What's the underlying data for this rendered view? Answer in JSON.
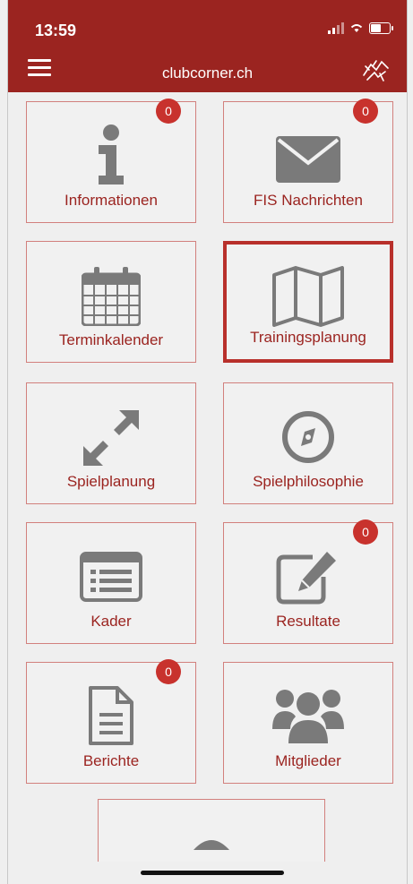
{
  "status": {
    "time": "13:59"
  },
  "header": {
    "title": "clubcorner.ch"
  },
  "tiles": [
    {
      "label": "Informationen",
      "badge": "0"
    },
    {
      "label": "FIS Nachrichten",
      "badge": "0"
    },
    {
      "label": "Terminkalender"
    },
    {
      "label": "Trainingsplanung"
    },
    {
      "label": "Spielplanung"
    },
    {
      "label": "Spielphilosophie"
    },
    {
      "label": "Kader"
    },
    {
      "label": "Resultate",
      "badge": "0"
    },
    {
      "label": "Berichte",
      "badge": "0"
    },
    {
      "label": "Mitglieder"
    }
  ],
  "colors": {
    "brand": "#9b2420",
    "badge": "#c8322d",
    "icon": "#7a7a7a"
  },
  "icons": [
    "info-icon",
    "envelope-icon",
    "calendar-icon",
    "map-icon",
    "expand-arrows-icon",
    "compass-icon",
    "list-card-icon",
    "edit-icon",
    "document-icon",
    "group-icon",
    "chevron-up-icon"
  ]
}
